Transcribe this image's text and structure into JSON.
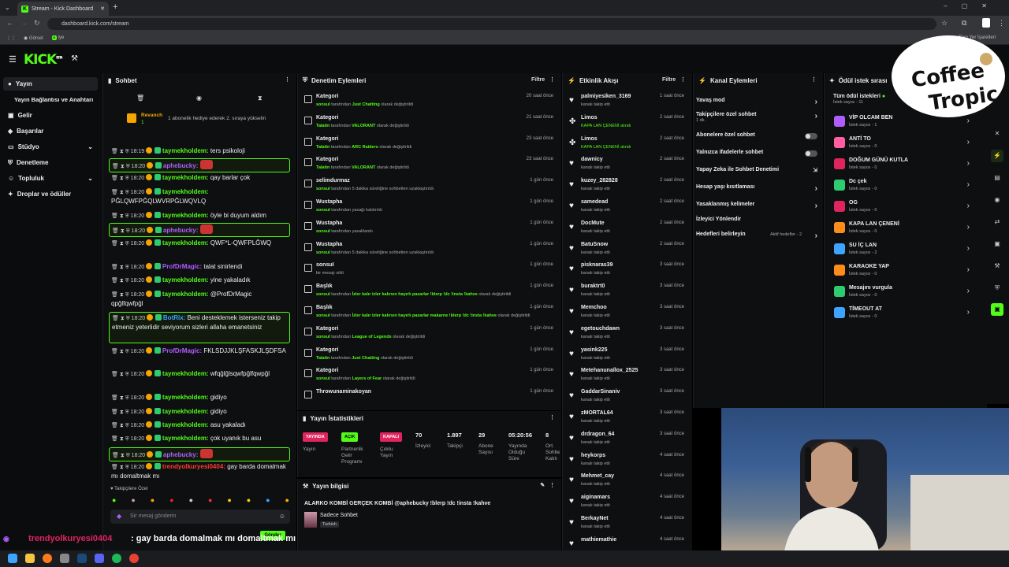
{
  "browser": {
    "tab_title": "Stream - Kick Dashboard",
    "url": "dashboard.kick.com/stream",
    "bookmarks": [
      "Görsel",
      "iye"
    ],
    "all_bookmarks": "Tüm Yer İşaretleri"
  },
  "app": {
    "logo": "KICK",
    "logo_sup": "BETA"
  },
  "nav": {
    "items": [
      "Yayın",
      "Yayın Bağlantısı ve Anahtarı",
      "Gelir",
      "Başarılar",
      "Stüdyo",
      "Denetleme",
      "Topluluk",
      "Droplar ve ödüller"
    ]
  },
  "chat": {
    "title": "Sohbet",
    "pinned": {
      "user": "Revanch",
      "count": "1",
      "text": "1 abonelik hediye ederek 2. sıraya yükselin"
    },
    "lines": [
      {
        "time": "18:19",
        "user": "taymekholdem:",
        "msg": "ters psikoloji"
      },
      {
        "time": "18:20",
        "user": "aphebucky:",
        "msg": ""
      },
      {
        "time": "18:20",
        "user": "taymekholdem:",
        "msg": "qay barlar çok"
      },
      {
        "time": "18:20",
        "user": "taymekholdem:",
        "msg": "PĞLQWFPĞQLWVRPĞLWQVLQ"
      },
      {
        "time": "18:20",
        "user": "taymekholdem:",
        "msg": "öyle bi duyum aldım"
      },
      {
        "time": "18:20",
        "user": "aphebucky:",
        "msg": ""
      },
      {
        "time": "18:20",
        "user": "taymekholdem:",
        "msg": "QWF*L-QWFPLĞWQ"
      },
      {
        "time": "18:20",
        "user": "ProfDrMagic:",
        "msg": "talat sinirlendi"
      },
      {
        "time": "18:20",
        "user": "taymekholdem:",
        "msg": "yine yakaladık"
      },
      {
        "time": "18:20",
        "user": "taymekholdem:",
        "msg": "@ProfDrMagic",
        "extra": "qpğlfqwfpğl"
      },
      {
        "time": "18:20",
        "user": "BotRix:",
        "msg": "Beni desteklemek isterseniz takip etmeniz yeterlidir seviyorum sizleri allaha emanetsiniz"
      },
      {
        "time": "18:20",
        "user": "ProfDrMagic:",
        "msg": "FKLSDJJKLŞFASKJLŞDFSA"
      },
      {
        "time": "18:20",
        "user": "taymekholdem:",
        "msg": "wfqğlğlsqwfpğlfqwpğl"
      },
      {
        "time": "18:20",
        "user": "taymekholdem:",
        "msg": "gidiyo"
      },
      {
        "time": "18:20",
        "user": "taymekholdem:",
        "msg": "gidiyo"
      },
      {
        "time": "18:20",
        "user": "taymekholdem:",
        "msg": "asu yakaladı"
      },
      {
        "time": "18:20",
        "user": "taymekholdem:",
        "msg": "çok uyanık bu asu"
      },
      {
        "time": "18:20",
        "user": "aphebucky:",
        "msg": ""
      },
      {
        "time": "18:20",
        "user": "trendyolkuryesi0404:",
        "msg": "gay barda domalmak mı domaltmak mı"
      }
    ],
    "emote_label": "Takipçilere Özel",
    "input_placeholder": "Sir mesaj gönderin",
    "send": "Gönder"
  },
  "moderation": {
    "title": "Denetim Eylemleri",
    "filter": "Filtre",
    "items": [
      {
        "title": "Kategori",
        "by": "sonsuI",
        "pre": "tarafından",
        "hl": "Just Chatting",
        "post": "olarak değiştirildi",
        "time": "20 saat önce"
      },
      {
        "title": "Kategori",
        "by": "Talatin",
        "pre": "tarafından",
        "hl": "VALORANT",
        "post": "olarak değiştirildi",
        "time": "21 saat önce"
      },
      {
        "title": "Kategori",
        "by": "Talatin",
        "pre": "tarafından",
        "hl": "ARC Raiders",
        "post": "olarak değiştirildi",
        "time": "23 saat önce"
      },
      {
        "title": "Kategori",
        "by": "Talatin",
        "pre": "tarafından",
        "hl": "VALORANT",
        "post": "olarak değiştirildi",
        "time": "23 saat önce"
      },
      {
        "title": "selimdurmaz",
        "by": "sonsuI",
        "pre": "tarafından 5 dakika süreliğine sohbetten uzaklaştırıldı",
        "hl": "",
        "post": "",
        "time": "1 gün önce"
      },
      {
        "title": "Wustapha",
        "by": "sonsuI",
        "pre": "tarafından yasağı kaldırıldı",
        "hl": "",
        "post": "",
        "time": "1 gün önce"
      },
      {
        "title": "Wustapha",
        "by": "sonsuI",
        "pre": "tarafından yasaklandı",
        "hl": "",
        "post": "",
        "time": "1 gün önce"
      },
      {
        "title": "Wustapha",
        "by": "sonsuI",
        "pre": "tarafından 5 dakika süreliğine sohbetten uzaklaştırıldı",
        "hl": "",
        "post": "",
        "time": "1 gün önce"
      },
      {
        "title": "sonsuI",
        "by": "",
        "pre": "bir mesajı sildi",
        "hl": "",
        "post": "",
        "time": "1 gün önce"
      },
      {
        "title": "Başlık",
        "by": "sonsuI",
        "pre": "tarafından",
        "hl": "İzler kalır izler kalırsın hayırlı pazarlar !blerp !dc !insta !kahve",
        "post": "olarak değiştirildi",
        "time": "1 gün önce"
      },
      {
        "title": "Başlık",
        "by": "sonsuI",
        "pre": "tarafından",
        "hl": "İzler kalır izler kalırsın hayırlı pazarlar makarne !blerp !dc !insta !kahve",
        "post": "olarak değiştirildi",
        "time": "1 gün önce"
      },
      {
        "title": "Kategori",
        "by": "sonsuI",
        "pre": "tarafından",
        "hl": "League of Legends",
        "post": "olarak değiştirildi",
        "time": "1 gün önce"
      },
      {
        "title": "Kategori",
        "by": "Talatin",
        "pre": "tarafından",
        "hl": "Just Chatting",
        "post": "olarak değiştirildi",
        "time": "1 gün önce"
      },
      {
        "title": "Kategori",
        "by": "sonsuI",
        "pre": "tarafından",
        "hl": "Layers of Fear",
        "post": "olarak değiştirildi",
        "time": "1 gün önce"
      },
      {
        "title": "Throwunaminakoyan",
        "by": "",
        "pre": "",
        "hl": "",
        "post": "",
        "time": "1 gün önce"
      }
    ]
  },
  "stats": {
    "title": "Yayın İstatistikleri",
    "items": [
      {
        "value": "YAYINDA",
        "label": "Yayın"
      },
      {
        "value": "AÇIK",
        "label": "Partnerlik Gelir Programı"
      },
      {
        "value": "KAPALI",
        "label": "Çoklu Yayın"
      },
      {
        "value": "70",
        "label": "İzleyici"
      },
      {
        "value": "1.897",
        "label": "Takipçi"
      },
      {
        "value": "29",
        "label": "Abone Sayısı"
      },
      {
        "value": "05:20:56",
        "label": "Yayında Olduğu Süre"
      },
      {
        "value": "8",
        "label": "Ort. Sohbet Katılı"
      }
    ]
  },
  "stream_info": {
    "title": "Yayın bilgisi",
    "stream_title": "ALARKO KOMBİ GERÇEK KOMBİ @aphebucky !blerp !dc !insta !kahve",
    "category": "Sadece Sohbet",
    "lang": "Turkish"
  },
  "activity": {
    "title": "Etkinlik Akışı",
    "filter": "Filtre",
    "items": [
      {
        "name": "palmiyesiken_3169",
        "sub": "kanalı takip etti",
        "time": "1 saat önce",
        "green": false
      },
      {
        "name": "Limos",
        "sub": "KAPA LAN ÇENENİ alındı",
        "time": "2 saat önce",
        "green": true
      },
      {
        "name": "Limos",
        "sub": "KAPA LAN ÇENENİ alındı",
        "time": "2 saat önce",
        "green": true
      },
      {
        "name": "dawnicy",
        "sub": "kanalı takip etti",
        "time": "2 saat önce",
        "green": false
      },
      {
        "name": "kuzey_282828",
        "sub": "kanalı takip etti",
        "time": "2 saat önce",
        "green": false
      },
      {
        "name": "samedead",
        "sub": "kanalı takip etti",
        "time": "2 saat önce",
        "green": false
      },
      {
        "name": "DocMute",
        "sub": "kanalı takip etti",
        "time": "2 saat önce",
        "green": false
      },
      {
        "name": "BatuSnow",
        "sub": "kanalı takip etti",
        "time": "2 saat önce",
        "green": false
      },
      {
        "name": "pisknaras39",
        "sub": "kanalı takip etti",
        "time": "3 saat önce",
        "green": false
      },
      {
        "name": "buraktrt0",
        "sub": "kanalı takip etti",
        "time": "3 saat önce",
        "green": false
      },
      {
        "name": "Memchoo",
        "sub": "kanalı takip etti",
        "time": "3 saat önce",
        "green": false
      },
      {
        "name": "egetouchdawn",
        "sub": "kanalı takip etti",
        "time": "3 saat önce",
        "green": false
      },
      {
        "name": "yasink225",
        "sub": "kanalı takip etti",
        "time": "3 saat önce",
        "green": false
      },
      {
        "name": "Metehanunallox_2525",
        "sub": "kanalı takip etti",
        "time": "3 saat önce",
        "green": false
      },
      {
        "name": "GaddarSinaniv",
        "sub": "kanalı takip etti",
        "time": "3 saat önce",
        "green": false
      },
      {
        "name": "zMORTAL64",
        "sub": "kanalı takip etti",
        "time": "3 saat önce",
        "green": false
      },
      {
        "name": "drdragon_64",
        "sub": "kanalı takip etti",
        "time": "3 saat önce",
        "green": false
      },
      {
        "name": "heykorps",
        "sub": "kanalı takip etti",
        "time": "4 saat önce",
        "green": false
      },
      {
        "name": "Mehmet_cay",
        "sub": "kanalı takip etti",
        "time": "4 saat önce",
        "green": false
      },
      {
        "name": "aiginamars",
        "sub": "kanalı takip etti",
        "time": "4 saat önce",
        "green": false
      },
      {
        "name": "BerkayNet",
        "sub": "kanalı takip etti",
        "time": "4 saat önce",
        "green": false
      },
      {
        "name": "mathiemathie",
        "sub": "",
        "time": "4 saat önce",
        "green": false
      }
    ]
  },
  "channel": {
    "title": "Kanal Eylemleri",
    "items": [
      "Yavaş mod",
      "Takipçilere özel sohbet",
      "Abonelere özel sohbet",
      "Yalnızca ifadelerle sohbet",
      "Yapay Zeka ile Sohbet Denetimi",
      "Hesap yaşı kısıtlaması",
      "Yasaklanmış kelimeler",
      "İzleyici Yönlendir",
      "Hedefleri belirleyin"
    ],
    "follower_sub": "1 dk.",
    "goals_sub": "Aktif hedefler - 2"
  },
  "rewards": {
    "title": "Ödül istek sırası",
    "all_label": "Tüm ödül istekleri",
    "all_sub": "İstek sayısı - 11",
    "items": [
      {
        "name": "VİP OLCAM BEN",
        "sub": "İstek sayısı - 1",
        "color": "#b15cff"
      },
      {
        "name": "ANTİ TO",
        "sub": "İstek sayısı - 0",
        "color": "#ff5fa2"
      },
      {
        "name": "DOĞUM GÜNÜ KUTLA",
        "sub": "İstek sayısı - 0",
        "color": "#e0245e"
      },
      {
        "name": "Dc çek",
        "sub": "İstek sayısı - 0",
        "color": "#2ecc71"
      },
      {
        "name": "OG",
        "sub": "İstek sayısı - 0",
        "color": "#e0245e"
      },
      {
        "name": "KAPA LAN ÇENENİ",
        "sub": "İstek sayısı - 0",
        "color": "#ff8c1a"
      },
      {
        "name": "SU İÇ LAN",
        "sub": "İstek sayısı - 2",
        "color": "#3da5ff"
      },
      {
        "name": "KARAOKE YAP",
        "sub": "İstek sayısı - 0",
        "color": "#ff8c1a"
      },
      {
        "name": "Mesajını vurgula",
        "sub": "İstek sayısı - 0",
        "color": "#2ecc71"
      },
      {
        "name": "TİMEOUT AT",
        "sub": "İstek sayısı - 0",
        "color": "#3da5ff"
      }
    ]
  },
  "overlay": {
    "logo_line1": "Coffee",
    "logo_line2": "Tropic",
    "chat_user": "trendyolkuryesi0404",
    "chat_msg": ": gay barda domalmak mı domaltmak mı"
  }
}
